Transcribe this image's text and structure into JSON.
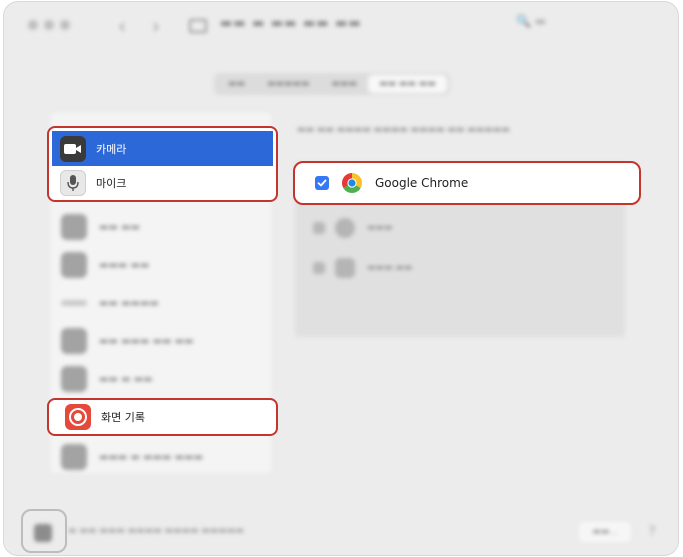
{
  "privacy": {
    "camera_label": "카메라",
    "microphone_label": "마이크",
    "screen_recording_label": "화면 기록"
  },
  "apps": {
    "chrome_label": "Google Chrome",
    "chrome_checked": true
  },
  "colors": {
    "highlight_border": "#c4352e",
    "selection_blue": "#2d68d8",
    "checkbox_blue": "#3478f6",
    "screen_record_red": "#e5493c"
  },
  "icons": [
    "camera-icon",
    "microphone-icon",
    "screen-record-icon",
    "chrome-icon",
    "checkbox-checked-icon"
  ]
}
